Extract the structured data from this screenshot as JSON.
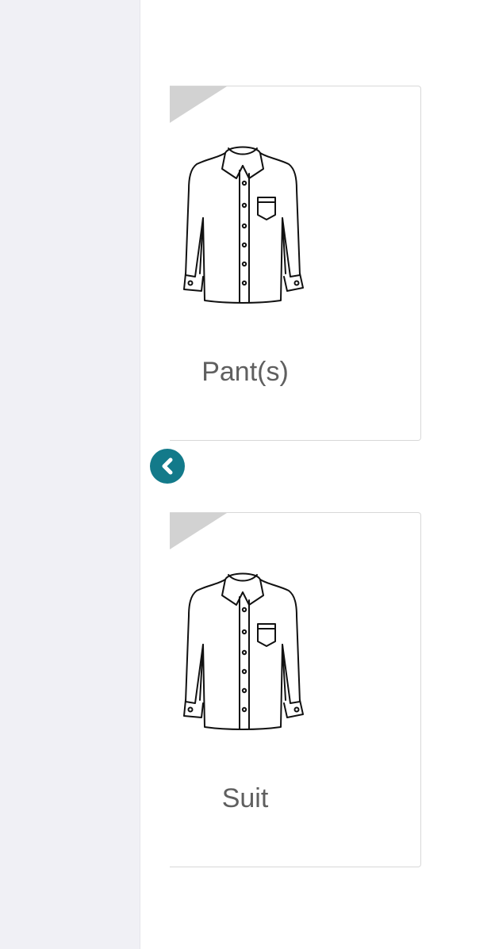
{
  "cards": [
    {
      "label": "Pant(s)",
      "icon": "shirt-icon"
    },
    {
      "label": "Suit",
      "icon": "shirt-icon"
    }
  ],
  "collapse_button": {
    "icon": "chevron-left-icon",
    "color": "#137a8a"
  },
  "colors": {
    "sidebar": "#f0f0f5",
    "card_border": "#d8d8d8",
    "corner": "#d2d2d2",
    "label_text": "#5f5f5f"
  }
}
